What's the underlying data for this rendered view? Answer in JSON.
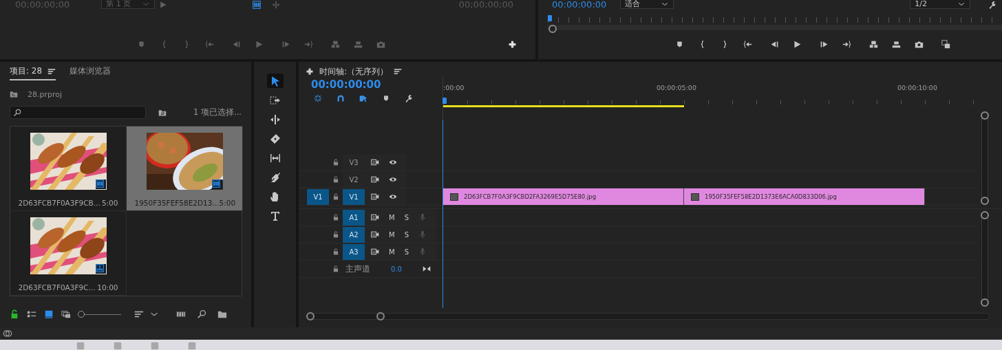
{
  "source_monitor": {
    "timecode_in": "00;00;00;00",
    "page_dropdown": "第 1 页",
    "timecode_out": "00;00;00;00"
  },
  "program_monitor": {
    "timecode": "00:00:00:00",
    "zoom_dropdown": "适合",
    "resolution_dropdown": "1/2"
  },
  "project_panel": {
    "tabs": [
      {
        "label": "项目: 28",
        "selected": true
      },
      {
        "label": "媒体浏览器",
        "selected": false
      }
    ],
    "file_name": "28.prproj",
    "selection_status": "1 项已选择...",
    "items": [
      {
        "name": "2D63FCB7F0A3F9CB...",
        "duration": "5:00",
        "selected": false,
        "kind": "clip"
      },
      {
        "name": "1950F35FEF58E2D13...",
        "duration": "5:00",
        "selected": true,
        "kind": "clip"
      },
      {
        "name": "2D63FCB7F0A3F9C...",
        "duration": "10:00",
        "selected": false,
        "kind": "sequence"
      }
    ],
    "zoom_slider": {
      "level": 0
    }
  },
  "tools": [
    {
      "kind": "selection",
      "selected": true
    },
    {
      "kind": "track-select",
      "selected": false
    },
    {
      "kind": "ripple",
      "selected": false
    },
    {
      "kind": "razor",
      "selected": false
    },
    {
      "kind": "slip",
      "selected": false
    },
    {
      "kind": "pen",
      "selected": false
    },
    {
      "kind": "hand",
      "selected": false
    },
    {
      "kind": "type",
      "selected": false
    }
  ],
  "timeline": {
    "title": "时间轴:（无序列）",
    "timecode": "00:00:00:00",
    "toolbar": [
      {
        "kind": "nest",
        "on": true
      },
      {
        "kind": "snap",
        "on": true
      },
      {
        "kind": "linked",
        "on": true
      },
      {
        "kind": "marker",
        "on": false
      },
      {
        "kind": "settings",
        "on": false
      }
    ],
    "ruler_labels": [
      ":00:00",
      "00:00:05:00",
      "00:00:10:00"
    ],
    "video_tracks": [
      {
        "name": "V3",
        "targeted": false
      },
      {
        "name": "V2",
        "targeted": false
      },
      {
        "name": "V1",
        "targeted": true,
        "source_patch": "V1",
        "clips": [
          {
            "name": "2D63FCB7F0A3F9CBD2FA3269E5D75E80.jpg"
          },
          {
            "name": "1950F35FEF58E2D1373E6ACA0D833D06.jpg"
          }
        ]
      }
    ],
    "audio_tracks": [
      {
        "name": "A1",
        "targeted": true,
        "mute": "M",
        "solo": "S"
      },
      {
        "name": "A2",
        "targeted": true,
        "mute": "M",
        "solo": "S"
      },
      {
        "name": "A3",
        "targeted": true,
        "mute": "M",
        "solo": "S"
      }
    ],
    "master": {
      "label": "主声道",
      "value": "0.0"
    }
  }
}
